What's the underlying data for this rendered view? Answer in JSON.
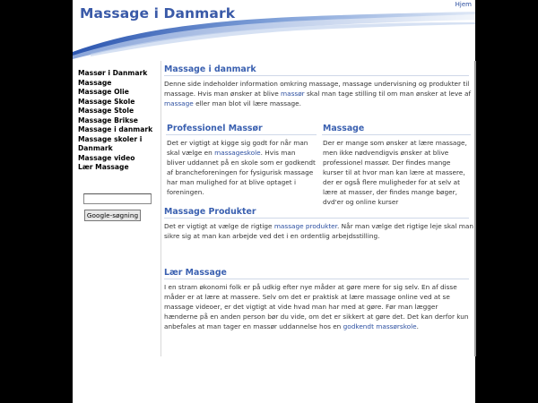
{
  "header": {
    "title": "Massage i Danmark",
    "home_link": "Hjem"
  },
  "sidebar": {
    "items": [
      {
        "label": "Massør i Danmark"
      },
      {
        "label": "Massage"
      },
      {
        "label": "Massage Olie"
      },
      {
        "label": "Massage Skole"
      },
      {
        "label": "Massage Stole"
      },
      {
        "label": "Massage Brikse"
      },
      {
        "label": "Massage i danmark"
      },
      {
        "label": "Massage skoler i Danmark"
      },
      {
        "label": "Massage video"
      },
      {
        "label": "Lær Massage"
      }
    ],
    "search": {
      "value": "",
      "button_label": "Google-søgning"
    }
  },
  "main": {
    "intro": {
      "heading": "Massage i danmark",
      "text1": "Denne side indeholder information omkring massage, massage undervisning og produkter til massage. Hvis man ønsker at blive ",
      "link1": "massør",
      "text2": " skal man tage stilling til om man ønsker at leve af ",
      "link2": "massage",
      "text3": " eller man blot vil lære massage."
    },
    "col_left": {
      "heading": "Professionel Massør",
      "text1": "Det er vigtigt at kigge sig godt for når man skal vælge en ",
      "link1": "massageskole",
      "text2": ". Hvis man bliver uddannet på en skole som er godkendt af brancheforeningen for fysigurisk massage har man mulighed for at blive optaget i foreningen."
    },
    "col_right": {
      "heading": "Massage",
      "text": "Der er mange som ønsker at lære massage, men ikke nødvendigvis ønsker at blive professionel massør. Der findes mange kurser til at hvor man kan lære at massere, der er også flere muligheder for at selv at lære at masser, der findes mange bøger, dvd'er og online kurser"
    },
    "products": {
      "heading": "Massage Produkter",
      "text1": "Det er vigtigt at vælge de rigtige ",
      "link1": "massage produkter",
      "text2": ". Når man vælge det rigtige leje skal man sikre sig at man kan arbejde ved det i en ordentlig arbejdsstilling."
    },
    "learn": {
      "heading": "Lær Massage",
      "text1": "I en stram økonomi folk er på udkig efter nye måder at gøre mere for sig selv. En af disse måder er at lære at massere. Selv om det er praktisk at lære massage online ved at se massage videoer, er det vigtigt at vide hvad man har med at gøre. Før man lægger hænderne på en anden person bør du vide, om det er sikkert at gøre det. Det kan derfor kun anbefales at man tager en massør uddannelse hos en ",
      "link1": "godkendt massørskole",
      "text2": "."
    }
  },
  "colors": {
    "title": "#3a5aa8",
    "link": "#2c4fa0",
    "heading": "#3a60b0",
    "background": "#000000"
  }
}
